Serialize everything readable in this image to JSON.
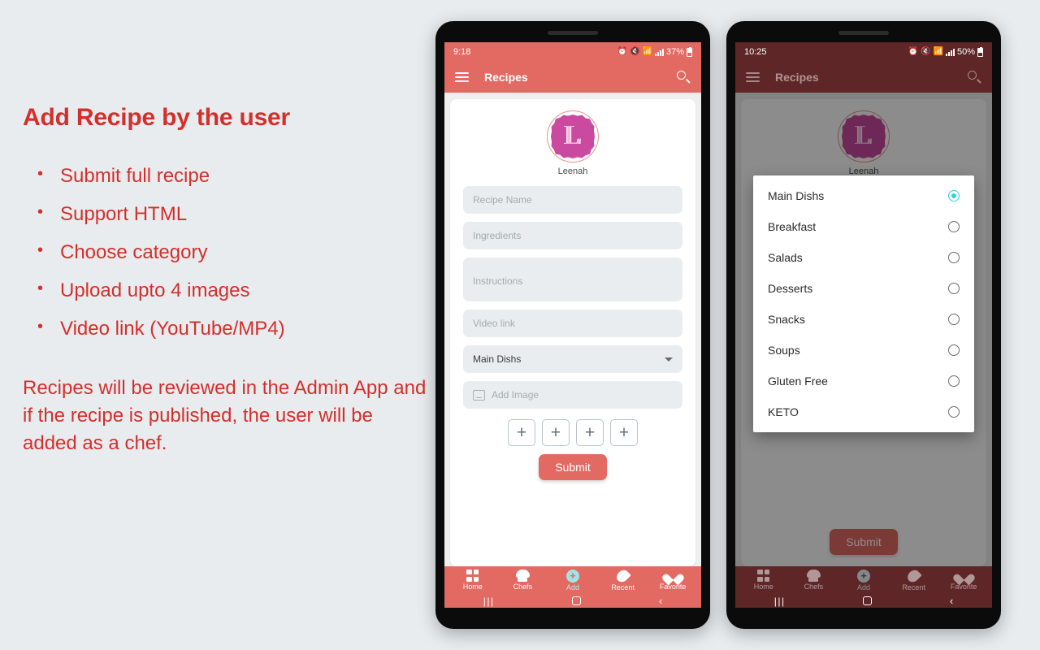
{
  "colors": {
    "page_bg": "#e8ecef",
    "accent_red": "#d32f2b",
    "appbar": "#e26a63",
    "appbar_dim": "#5e2626",
    "submit": "#e26a63",
    "avatar_pink": "#c94a9e",
    "radio_selected": "#2ed4dd",
    "add_icon_cyan": "#9fe5e8"
  },
  "slide": {
    "title": "Add Recipe by the user",
    "bullets": [
      "Submit full recipe",
      "Support HTML",
      "Choose category",
      "Upload upto 4 images",
      "Video link (YouTube/MP4)"
    ],
    "bullet_glyph": "•",
    "paragraph": "Recipes will be reviewed in the Admin App and if the recipe is published, the user will be added as a chef."
  },
  "phone1": {
    "status": {
      "time": "9:18",
      "battery": "37%"
    },
    "appbar": {
      "title": "Recipes",
      "menu_icon": "hamburger-menu-icon",
      "search_icon": "search-icon"
    },
    "profile": {
      "initial": "L",
      "name": "Leenah"
    },
    "form": {
      "recipe_name_placeholder": "Recipe Name",
      "ingredients_placeholder": "Ingredients",
      "instructions_placeholder": "Instructions",
      "video_link_placeholder": "Video link",
      "category_value": "Main Dishs",
      "add_image_label": "Add Image",
      "image_slots": [
        "+",
        "+",
        "+",
        "+"
      ],
      "submit_label": "Submit"
    },
    "bottom_nav": [
      {
        "label": "Home",
        "icon": "grid-icon"
      },
      {
        "label": "Chefs",
        "icon": "chef-hat-icon"
      },
      {
        "label": "Add",
        "icon": "plus-circle-icon"
      },
      {
        "label": "Recent",
        "icon": "flame-icon"
      },
      {
        "label": "Favorite",
        "icon": "heart-icon"
      }
    ],
    "system_nav": {
      "recents": "|||",
      "home": "home-square-icon",
      "back": "‹"
    }
  },
  "phone2": {
    "status": {
      "time": "10:25",
      "battery": "50%"
    },
    "appbar": {
      "title": "Recipes",
      "menu_icon": "hamburger-menu-icon",
      "search_icon": "search-icon"
    },
    "profile": {
      "initial": "L",
      "name": "Leenah"
    },
    "form": {
      "submit_label": "Submit"
    },
    "dialog": {
      "options": [
        {
          "label": "Main Dishs",
          "selected": true
        },
        {
          "label": "Breakfast",
          "selected": false
        },
        {
          "label": "Salads",
          "selected": false
        },
        {
          "label": "Desserts",
          "selected": false
        },
        {
          "label": "Snacks",
          "selected": false
        },
        {
          "label": "Soups",
          "selected": false
        },
        {
          "label": "Gluten Free",
          "selected": false
        },
        {
          "label": "KETO",
          "selected": false
        }
      ]
    },
    "bottom_nav": [
      {
        "label": "Home",
        "icon": "grid-icon"
      },
      {
        "label": "Chefs",
        "icon": "chef-hat-icon"
      },
      {
        "label": "Add",
        "icon": "plus-circle-icon"
      },
      {
        "label": "Recent",
        "icon": "flame-icon"
      },
      {
        "label": "Favorite",
        "icon": "heart-icon"
      }
    ],
    "system_nav": {
      "recents": "|||",
      "home": "home-square-icon",
      "back": "‹"
    }
  }
}
